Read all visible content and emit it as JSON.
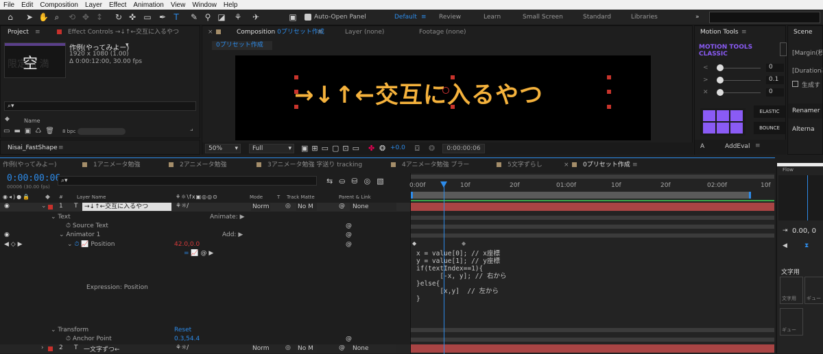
{
  "menu": [
    "File",
    "Edit",
    "Composition",
    "Layer",
    "Effect",
    "Animation",
    "View",
    "Window",
    "Help"
  ],
  "toolbar": {
    "auto_open": "Auto-Open Panel",
    "workspaces": [
      "Default",
      "Review",
      "Learn",
      "Small Screen",
      "Standard",
      "Libraries"
    ]
  },
  "project": {
    "tab": "Project",
    "effect_tab": "Effect Controls →↓↑←交互に入るやつ",
    "thumb_text": "空",
    "thumb_bg_text": "限定品 満",
    "comp_name": "作例(やってみよー)",
    "dims": "1920 x 1080 (1.00)",
    "duration": "Δ 0:00:12:00, 30.00 fps",
    "search_icon": "⌕▾",
    "col_name": "Name",
    "bpc": "8 bpc"
  },
  "comp": {
    "tab": "Composition",
    "tab_name": "0プリセット作成",
    "layer": "Layer (none)",
    "footage": "Footage (none)",
    "crumb": "0プリセット作成",
    "viewer_text": "→↓↑←交互に入るやつ",
    "zoom": "50%",
    "quality": "Full",
    "exposure": "+0.0",
    "timecode": "0:00:00:06"
  },
  "motion": {
    "tab": "Motion Tools",
    "logo1": "MOTION TOOLS",
    "logo2": "CLASSIC",
    "v1": "0",
    "v2": "0.1",
    "v3": "0",
    "elastic": "ELASTIC",
    "bounce": "BOUNCE",
    "a": "A",
    "addeval": "AddEval"
  },
  "scene": {
    "tab": "Scene",
    "lines": [
      "[Margin(秒",
      "[Duration基",
      "生成す"
    ],
    "renamer": "Renamer",
    "alterna": "Alterna",
    "flow": "Flow",
    "flow_val": "0.00, 0",
    "section": "文字用",
    "curve1": "文字用",
    "curve2": "ギュー",
    "curve3": "ギュー"
  },
  "tl_tabs": [
    "作例(やってみよー)",
    "1アニメータ勉強",
    "2アニメータ勉強",
    "3アニメータ勉強 字送り tracking",
    "4アニメータ勉強 ブラー",
    "5文字ずらし",
    "0プリセット作成"
  ],
  "tl_tab_colors": [
    "#a58e6a",
    "#a58e6a",
    "#a58e6a",
    "#a58e6a",
    "#a58e6a",
    "#a58e6a",
    "#a58e6a"
  ],
  "timeline": {
    "time": "0:00:00:06",
    "frames": "00006 (30.00 fps)",
    "col_layer": "Layer Name",
    "col_mode": "Mode",
    "col_t": "T",
    "col_track": "Track Matte",
    "col_parent": "Parent & Link",
    "ruler": [
      "0:00f",
      "10f",
      "20f",
      "01:00f",
      "10f",
      "20f",
      "02:00f",
      "10f"
    ],
    "layer1_num": "1",
    "layer1_name": "→↓↑←交互に入るやつ",
    "layer1_mode": "Norm",
    "layer1_matte": "No M",
    "layer1_parent": "None",
    "text": "Text",
    "animate": "Animate:",
    "source": "Source Text",
    "animator": "Animator 1",
    "add": "Add:",
    "position": "Position",
    "pos_val": "42.0,0.0",
    "expr_label": "Expression: Position",
    "transform": "Transform",
    "reset": "Reset",
    "anchor": "Anchor Point",
    "anchor_val": "0.3,54.4",
    "layer2_num": "2",
    "layer2_name": "一文字ずつ←",
    "layer2_mode": "Norm",
    "layer2_matte": "No M",
    "layer2_parent": "None",
    "code": [
      "x = value[0]; // x座標",
      "y = value[1]; // y座標",
      "",
      "if(textIndex==1){",
      "      [-x, y]; // 右から",
      "}else{",
      "      [x,y]  // 左から",
      "}"
    ]
  }
}
